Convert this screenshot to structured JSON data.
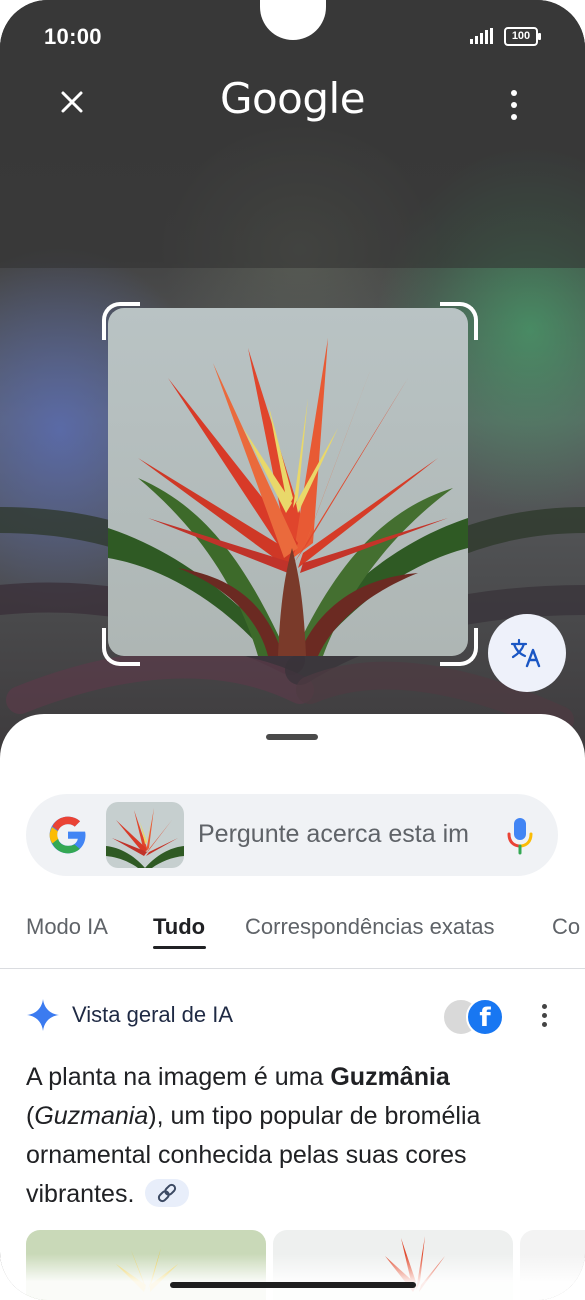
{
  "status_bar": {
    "time": "10:00",
    "battery": "100"
  },
  "app_bar": {
    "title": "Google",
    "close_icon": "close-icon",
    "more_icon": "more-vert-icon"
  },
  "lens": {
    "translate_icon": "translate-icon"
  },
  "search": {
    "placeholder": "Pergunte acerca esta imagem",
    "google_icon": "google-g-icon",
    "mic_icon": "mic-icon"
  },
  "tabs": [
    "Modo IA",
    "Tudo",
    "Correspondências exatas",
    "Co"
  ],
  "active_tab": "Tudo",
  "ai_overview": {
    "title": "Vista geral de IA",
    "sources": [
      "website-icon",
      "facebook-icon"
    ],
    "answer_pre": "A planta na imagem é uma ",
    "answer_bold": "Guzmânia",
    "answer_open": "(",
    "answer_italic": "Guzmania",
    "answer_post": "), um tipo popular de bromélia ornamental conhecida pelas suas cores vibrantes.",
    "link_icon": "link-icon"
  },
  "colors": {
    "google_blue": "#4285F4",
    "google_red": "#EA4335",
    "google_yellow": "#FBBC05",
    "google_green": "#34A853",
    "facebook_blue": "#1877F2"
  }
}
